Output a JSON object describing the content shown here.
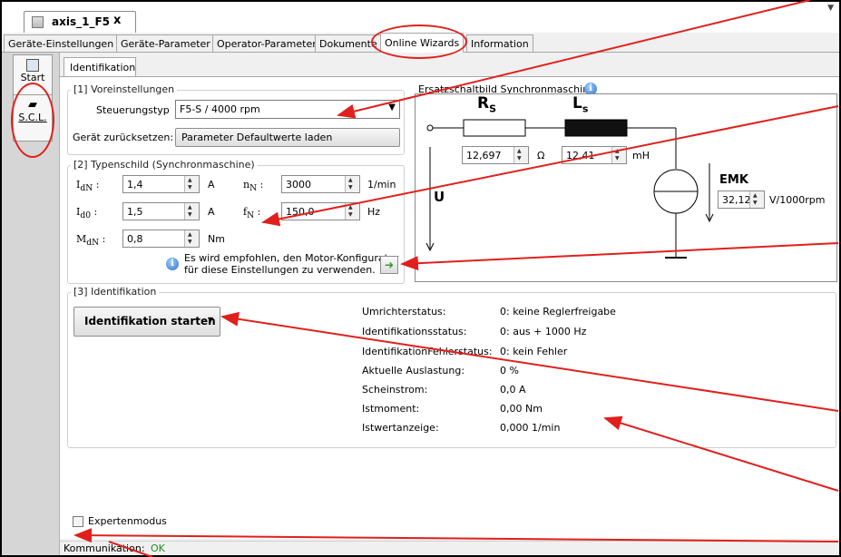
{
  "document_tab": {
    "title": "axis_1_F5",
    "close": "x"
  },
  "tabs": [
    {
      "label": "Geräte-Einstellungen"
    },
    {
      "label": "Geräte-Parameter"
    },
    {
      "label": "Operator-Parameter"
    },
    {
      "label": "Dokumente"
    },
    {
      "label": "Online Wizards"
    },
    {
      "label": "Information"
    }
  ],
  "sidebar": {
    "items": [
      {
        "label": "Start",
        "icon": "start-icon"
      },
      {
        "label": "S.C.L.",
        "icon": "motor-icon"
      }
    ]
  },
  "subtab": {
    "label": "Identifikation"
  },
  "voreinstellungen": {
    "legend": "[1] Voreinstellungen",
    "steuerungstyp_label": "Steuerungstyp",
    "steuerungstyp_value": "F5-S / 4000 rpm",
    "reset_label": "Gerät zurücksetzen:",
    "reset_button": "Parameter Defaultwerte laden"
  },
  "typenschild": {
    "legend": "[2] Typenschild (Synchronmaschine)",
    "idn": {
      "label": "I",
      "sub": "dN",
      "sep": ":",
      "value": "1,4",
      "unit": "A"
    },
    "nn": {
      "label": "n",
      "sub": "N",
      "sep": ":",
      "value": "3000",
      "unit": "1/min"
    },
    "id0": {
      "label": "I",
      "sub": "d0",
      "sep": ":",
      "value": "1,5",
      "unit": "A"
    },
    "fn": {
      "label": "f",
      "sub": "N",
      "sep": ":",
      "value": "150,0",
      "unit": "Hz"
    },
    "mdn": {
      "label": "M",
      "sub": "dN",
      "sep": ":",
      "value": "0,8",
      "unit": "Nm"
    },
    "hint_line1": "Es wird empfohlen, den Motor-Konfigurator",
    "hint_line2": "für diese Einstellungen zu verwenden."
  },
  "ersatzschaltbild": {
    "title": "Ersatzschaltbild Synchronmaschine",
    "rs_label": "R",
    "rs_sub": "S",
    "rs_value": "12,697",
    "rs_unit": "Ω",
    "ls_label": "L",
    "ls_sub": "s",
    "ls_value": "12,41",
    "ls_unit": "mH",
    "u_label": "U",
    "emk_label": "EMK",
    "emk_value": "32,12",
    "emk_unit": "V/1000rpm"
  },
  "identifikation": {
    "legend": "[3] Identifikation",
    "start_button": "Identifikation starten",
    "status_rows": [
      {
        "label": "Umrichterstatus:",
        "value": "0: keine Reglerfreigabe"
      },
      {
        "label": "Identifikationsstatus:",
        "value": "0: aus + 1000 Hz"
      },
      {
        "label": "IdentifikationFehlerstatus:",
        "value": "0: kein Fehler"
      },
      {
        "label": "Aktuelle Auslastung:",
        "value": "0 %"
      },
      {
        "label": "Scheinstrom:",
        "value": "0,0 A"
      },
      {
        "label": "Istmoment:",
        "value": "0,00 Nm"
      },
      {
        "label": "Istwertanzeige:",
        "value": "0,000 1/min"
      }
    ]
  },
  "expertenmodus": {
    "label": "Expertenmodus",
    "checked": false
  },
  "statusbar": {
    "label": "Kommunikation:",
    "value": "OK"
  },
  "colors": {
    "annotation": "#e0201c",
    "ok": "#1e8c1e"
  }
}
